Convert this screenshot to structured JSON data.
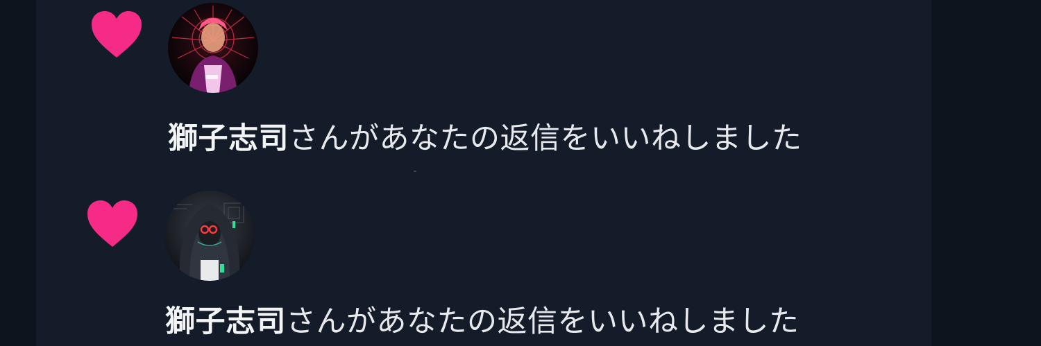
{
  "colors": {
    "background": "#0d141d",
    "panel": "#141c29",
    "heart": "#f52b87",
    "text": "#e7e9ec"
  },
  "notifications": [
    {
      "icon": "heart-icon",
      "avatar": "user-avatar-1",
      "user_name": "獅子志司",
      "action_text": "さんがあなたの返信をいいねしました"
    },
    {
      "icon": "heart-icon",
      "avatar": "user-avatar-2",
      "user_name": "獅子志司",
      "action_text": "さんがあなたの返信をいいねしました"
    }
  ]
}
